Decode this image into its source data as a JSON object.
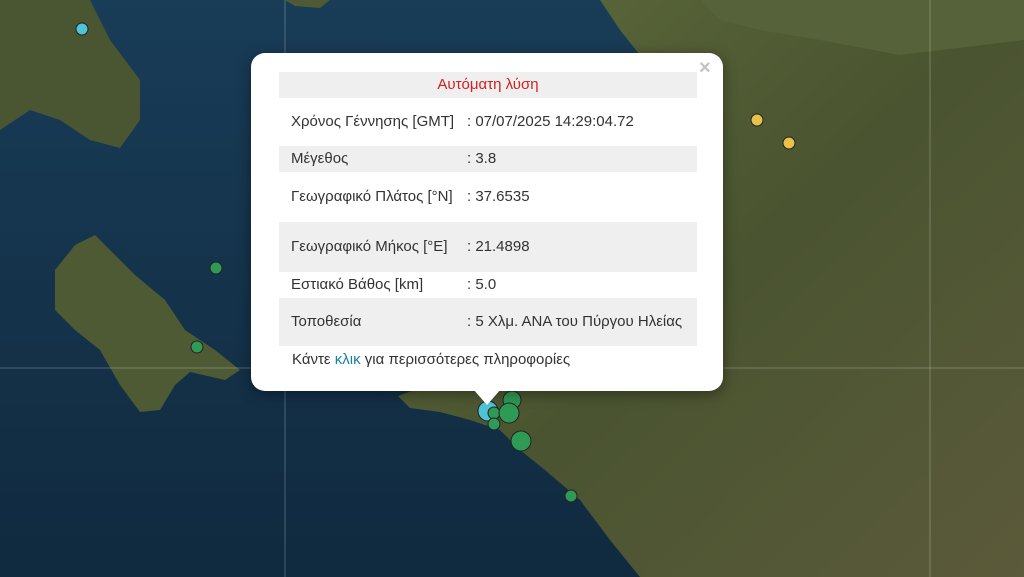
{
  "popup": {
    "title": "Αυτόματη λύση",
    "close_glyph": "×",
    "rows": [
      {
        "label": "Χρόνος Γέννησης [GMT]",
        "value": ": 07/07/2025 14:29:04.72"
      },
      {
        "label": "Μέγεθος",
        "value": ": 3.8"
      },
      {
        "label": "Γεωγραφικό Πλάτος [°N]",
        "value": ": 37.6535"
      },
      {
        "label": "Γεωγραφικό Μήκος [°E]",
        "value": ": 21.4898"
      },
      {
        "label": "Εστιακό Βάθος [km]",
        "value": ": 5.0"
      },
      {
        "label": "Τοποθεσία",
        "value": ": 5 Χλμ. ΑΝΑ του Πύργου Ηλείας"
      }
    ],
    "more_prefix": "Κάντε",
    "more_link": "κλικ",
    "more_suffix": "για περισσότερες πληροφορίες"
  },
  "colors": {
    "sea": "#16364f",
    "land": "#4f5a34",
    "marker_green": "#2e9a55",
    "marker_cyan": "#4ec4d6",
    "marker_yellow": "#e8c248",
    "title_red": "#d21f1f",
    "link_blue": "#1a7fa6"
  },
  "legend_marker_types": [
    "green-quake-marker",
    "cyan-recent-quake-marker",
    "yellow-quake-marker"
  ]
}
